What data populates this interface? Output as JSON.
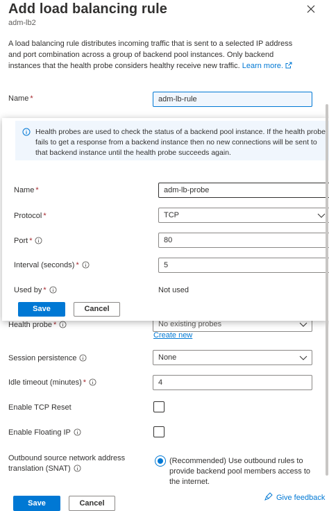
{
  "panel": {
    "title": "Add load balancing rule",
    "subtitle": "adm-lb2",
    "description": "A load balancing rule distributes incoming traffic that is sent to a selected IP address and port combination across a group of backend pool instances. Only backend instances that the health probe considers healthy receive new traffic.",
    "learn_more": "Learn more."
  },
  "rule": {
    "name_label": "Name",
    "name_value": "adm-lb-rule",
    "health_probe_label": "Health probe",
    "health_probe_value": "No existing probes",
    "create_new": "Create new",
    "session_persistence_label": "Session persistence",
    "session_persistence_value": "None",
    "idle_timeout_label": "Idle timeout (minutes)",
    "idle_timeout_value": "4",
    "tcp_reset_label": "Enable TCP Reset",
    "floating_ip_label": "Enable Floating IP",
    "snat_label": "Outbound source network address translation (SNAT)",
    "snat_option": "(Recommended) Use outbound rules to provide backend pool members access to the internet."
  },
  "probe_popup": {
    "info_text": "Health probes are used to check the status of a backend pool instance. If the health probe fails to get a response from a backend instance then no new connections will be sent to that backend instance until the health probe succeeds again.",
    "name_label": "Name",
    "name_value": "adm-lb-probe",
    "protocol_label": "Protocol",
    "protocol_value": "TCP",
    "port_label": "Port",
    "port_value": "80",
    "interval_label": "Interval (seconds)",
    "interval_value": "5",
    "used_by_label": "Used by",
    "used_by_value": "Not used",
    "save": "Save",
    "cancel": "Cancel"
  },
  "footer": {
    "save": "Save",
    "cancel": "Cancel",
    "feedback": "Give feedback"
  },
  "colors": {
    "accent": "#0078d4",
    "required": "#a4262c",
    "info_background": "#f0f6fd"
  },
  "icons": [
    "close-icon",
    "external-link-icon",
    "info-icon",
    "chevron-down-icon",
    "feedback-icon"
  ]
}
